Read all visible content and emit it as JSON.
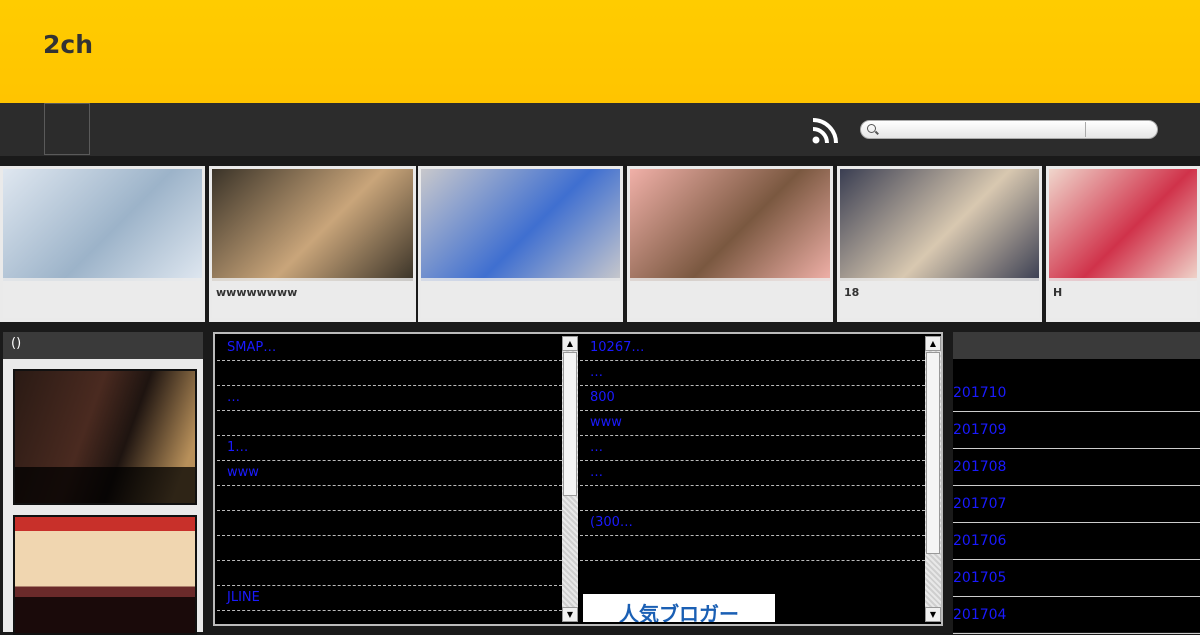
{
  "header": {
    "site_title": "2ch"
  },
  "nav": {
    "rss_icon": "rss-icon",
    "search_placeholder": ""
  },
  "thumbnails": [
    {
      "caption": "",
      "colors": [
        "#dfe7f0",
        "#9cb3c9"
      ]
    },
    {
      "caption": "wwwwwwww",
      "colors": [
        "#3a3328",
        "#c9a57a"
      ]
    },
    {
      "caption": "",
      "colors": [
        "#c8c8cc",
        "#3f6fd0"
      ]
    },
    {
      "caption": "",
      "colors": [
        "#f0b0a8",
        "#7a5840"
      ]
    },
    {
      "caption": "18",
      "colors": [
        "#3a3e52",
        "#d8c8b0"
      ]
    },
    {
      "caption": "H",
      "colors": [
        "#f0d6cc",
        "#d0324a"
      ]
    }
  ],
  "left_column": {
    "heading": "()"
  },
  "feed_left": [
    "SMAP…",
    "",
    "…",
    "",
    "1…",
    "www",
    "",
    "",
    "",
    "",
    "JLINE"
  ],
  "feed_right": [
    "10267…",
    "…",
    "800",
    "www",
    "…",
    "…",
    "",
    "(300…",
    ""
  ],
  "banner_text": "人気ブロガー",
  "archives": [
    "201710",
    "201709",
    "201708",
    "201707",
    "201706",
    "201705",
    "201704"
  ]
}
